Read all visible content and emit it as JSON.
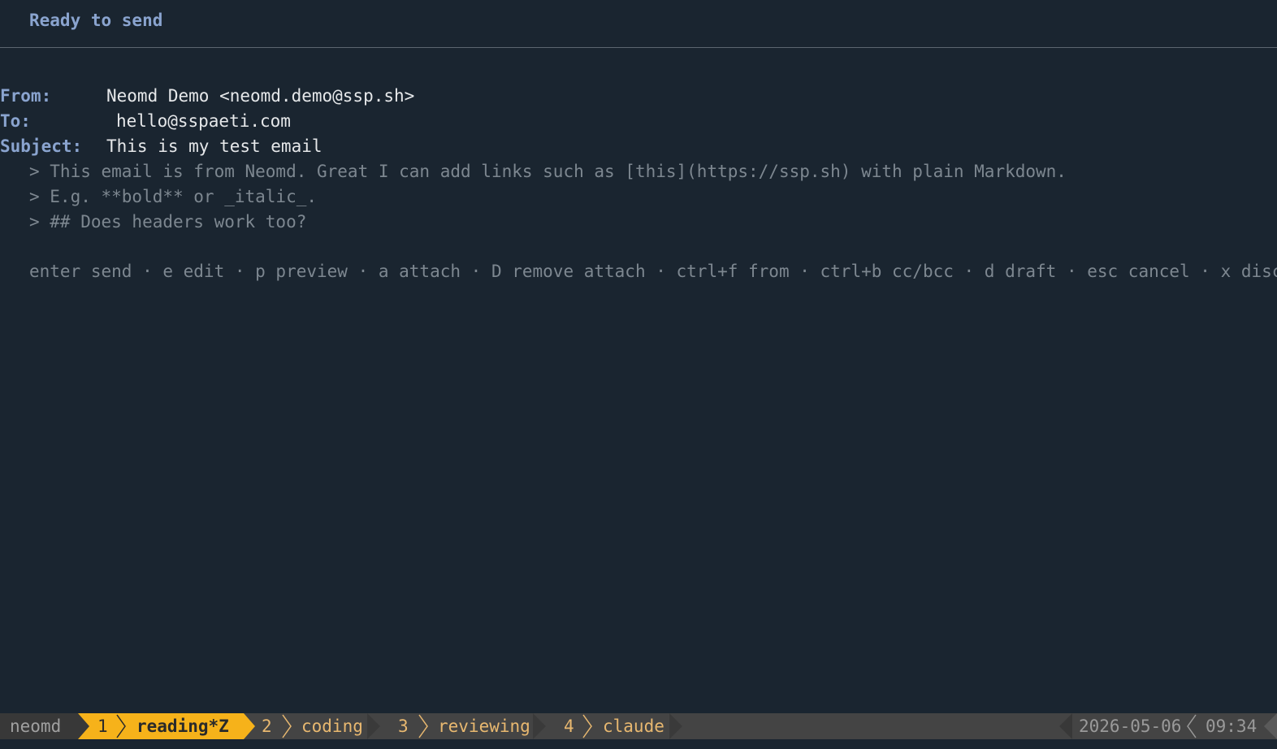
{
  "compose": {
    "status_title": "Ready to send",
    "from_label": "From:",
    "from_value": "Neomd Demo <neomd.demo@ssp.sh>",
    "to_label": "To:",
    "to_value": "hello@sspaeti.com",
    "subject_label": "Subject:",
    "subject_value": "This is my test email",
    "body_lines": [
      "> This email is from Neomd. Great I can add links such as [this](https://ssp.sh) with plain Markdown.",
      "> E.g. **bold** or _italic_.",
      "> ## Does headers work too?"
    ],
    "keybindings": "enter send · e edit · p preview · a attach · D remove attach · ctrl+f from · ctrl+b cc/bcc · d draft · esc cancel · x discard"
  },
  "tmux": {
    "session": "neomd",
    "windows": [
      {
        "index": "1",
        "name": "reading*Z",
        "active": true
      },
      {
        "index": "2",
        "name": "coding",
        "active": false
      },
      {
        "index": "3",
        "name": "reviewing",
        "active": false
      },
      {
        "index": "4",
        "name": "claude",
        "active": false
      }
    ],
    "date": "2026-05-06",
    "time": "09:34"
  },
  "colors": {
    "background": "#1a2530",
    "label_blue": "#8aa4cf",
    "muted_text": "#7d8790",
    "status_bar_bg": "#444444",
    "active_window_bg": "#f6b21a",
    "inactive_window_text": "#e8b870"
  }
}
